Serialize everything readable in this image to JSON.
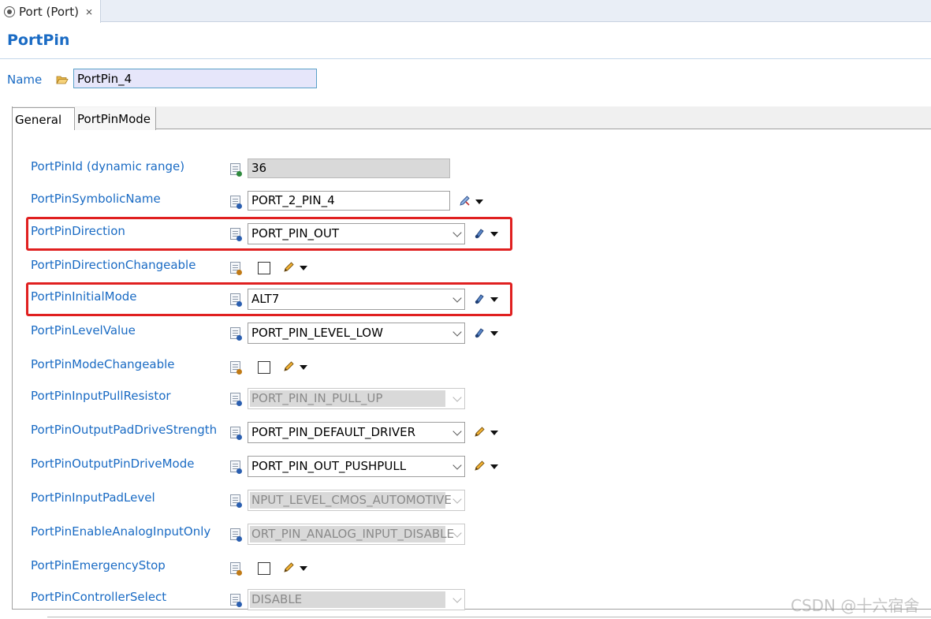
{
  "editor_tab": {
    "label": "Port (Port)",
    "close": "⨯"
  },
  "page_title": "PortPin",
  "name_field": {
    "label": "Name",
    "value": "PortPin_4"
  },
  "tabs": [
    {
      "label": "General"
    },
    {
      "label": "PortPinMode"
    }
  ],
  "params": [
    {
      "label": "PortPinId (dynamic range)",
      "control": "readonly",
      "value": "36",
      "icon": "doc-number-icon"
    },
    {
      "label": "PortPinSymbolicName",
      "control": "text",
      "value": "PORT_2_PIN_4",
      "icon": "doc-text-icon",
      "action": "edit-link-icon"
    },
    {
      "label": "PortPinDirection",
      "control": "combo",
      "value": "PORT_PIN_OUT",
      "icon": "doc-icon",
      "action": "link-icon",
      "highlighted": true
    },
    {
      "label": "PortPinDirectionChangeable",
      "control": "checkbox",
      "checked": false,
      "icon": "xy-icon",
      "action": "pencil-icon"
    },
    {
      "label": "PortPinInitialMode",
      "control": "combo",
      "value": "ALT7",
      "icon": "doc-icon",
      "action": "link-icon",
      "highlighted": true
    },
    {
      "label": "PortPinLevelValue",
      "control": "combo",
      "value": "PORT_PIN_LEVEL_LOW",
      "icon": "doc-icon",
      "action": "link-icon"
    },
    {
      "label": "PortPinModeChangeable",
      "control": "checkbox",
      "checked": false,
      "icon": "xy-icon",
      "action": "pencil-icon"
    },
    {
      "label": "PortPinInputPullResistor",
      "control": "combo-disabled",
      "value": "PORT_PIN_IN_PULL_UP",
      "icon": "doc-blue-icon"
    },
    {
      "label": "PortPinOutputPadDriveStrength",
      "control": "combo",
      "value": "PORT_PIN_DEFAULT_DRIVER",
      "icon": "doc-blue-icon",
      "action": "pencil-icon"
    },
    {
      "label": "PortPinOutputPinDriveMode",
      "control": "combo",
      "value": "PORT_PIN_OUT_PUSHPULL",
      "icon": "doc-blue-icon",
      "action": "pencil-icon"
    },
    {
      "label": "PortPinInputPadLevel",
      "control": "combo-disabled",
      "value": "NPUT_LEVEL_CMOS_AUTOMOTIVE",
      "icon": "doc-blue-icon"
    },
    {
      "label": "PortPinEnableAnalogInputOnly",
      "control": "combo-disabled",
      "value": "ORT_PIN_ANALOG_INPUT_DISABLE",
      "icon": "doc-blue-icon"
    },
    {
      "label": "PortPinEmergencyStop",
      "control": "checkbox",
      "checked": false,
      "icon": "xy-icon",
      "action": "pencil-icon"
    },
    {
      "label": "PortPinControllerSelect",
      "control": "combo-disabled",
      "value": "DISABLE",
      "icon": "doc-blue-icon"
    }
  ],
  "watermark": "CSDN @十六宿舍",
  "colors": {
    "label_blue": "#1a6bc4",
    "highlight_red": "#e02020"
  }
}
